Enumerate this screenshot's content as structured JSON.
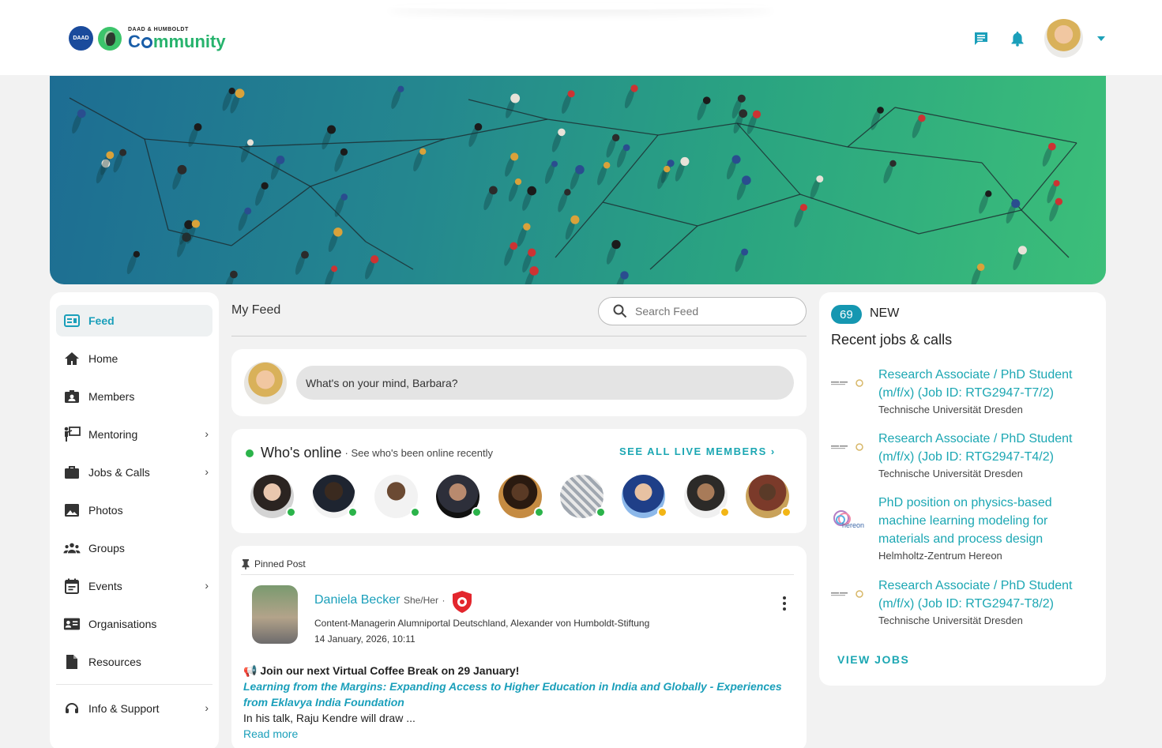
{
  "header": {
    "logo_badge": "DAAD",
    "logo_sub": "DAAD & HUMBOLDT",
    "logo_main_a": "C",
    "logo_main_b": "mmunity",
    "icons": [
      "chat-icon",
      "bell-icon"
    ],
    "colors": {
      "accent": "#1a9fba",
      "brand_blue": "#1a5ea8",
      "brand_green": "#27b36d"
    }
  },
  "nav": {
    "items": [
      {
        "label": "Feed",
        "icon": "feed-icon",
        "active": true,
        "has_submenu": false
      },
      {
        "label": "Home",
        "icon": "home-icon",
        "active": false,
        "has_submenu": false
      },
      {
        "label": "Members",
        "icon": "members-icon",
        "active": false,
        "has_submenu": false
      },
      {
        "label": "Mentoring",
        "icon": "mentoring-icon",
        "active": false,
        "has_submenu": true
      },
      {
        "label": "Jobs & Calls",
        "icon": "briefcase-icon",
        "active": false,
        "has_submenu": true
      },
      {
        "label": "Photos",
        "icon": "photo-icon",
        "active": false,
        "has_submenu": false
      },
      {
        "label": "Groups",
        "icon": "groups-icon",
        "active": false,
        "has_submenu": false
      },
      {
        "label": "Events",
        "icon": "calendar-icon",
        "active": false,
        "has_submenu": true
      },
      {
        "label": "Organisations",
        "icon": "organisation-icon",
        "active": false,
        "has_submenu": false
      },
      {
        "label": "Resources",
        "icon": "document-icon",
        "active": false,
        "has_submenu": false
      }
    ],
    "support": {
      "label": "Info & Support",
      "icon": "support-icon",
      "has_submenu": true
    },
    "chevron": "›"
  },
  "feed": {
    "title": "My Feed",
    "search_placeholder": "Search Feed",
    "compose_placeholder": "What's on your mind, Barbara?"
  },
  "online": {
    "title": "Who's online",
    "subtitle": "· See who's been online recently",
    "see_all": "SEE ALL LIVE MEMBERS ›",
    "members": [
      {
        "status": "online",
        "color": "#2bb34a"
      },
      {
        "status": "online",
        "color": "#2bb34a"
      },
      {
        "status": "online",
        "color": "#2bb34a"
      },
      {
        "status": "online",
        "color": "#2bb34a"
      },
      {
        "status": "online",
        "color": "#2bb34a"
      },
      {
        "status": "online",
        "color": "#2bb34a"
      },
      {
        "status": "recent",
        "color": "#f2b515"
      },
      {
        "status": "recent",
        "color": "#f2b515"
      },
      {
        "status": "recent",
        "color": "#f2b515"
      }
    ]
  },
  "pinned_post": {
    "label": "Pinned Post",
    "author": "Daniela Becker",
    "pronouns": "She/Her",
    "separator": "·",
    "role": "Content-Managerin Alumniportal Deutschland, Alexander von Humboldt-Stiftung",
    "date": "14 January, 2026, 10:11",
    "headline": "📢 Join our next Virtual Coffee Break on 29 January!",
    "link_text": "Learning from the Margins: Expanding Access to Higher Education in India and Globally - Experiences from Eklavya India Foundation",
    "excerpt": "In his talk, Raju Kendre will draw ...",
    "read_more": "Read more"
  },
  "jobs": {
    "count": "69",
    "new_label": "NEW",
    "title": "Recent jobs & calls",
    "items": [
      {
        "title": "Research Associate / PhD Student (m/f/x) (Job ID: RTG2947-T7/2)",
        "org": "Technische Universität Dresden",
        "logo": "tud-logo"
      },
      {
        "title": "Research Associate / PhD Student (m/f/x) (Job ID: RTG2947-T4/2)",
        "org": "Technische Universität Dresden",
        "logo": "tud-logo"
      },
      {
        "title": "PhD position on physics-based machine learning modeling for materials and process design",
        "org": "Helmholtz-Zentrum Hereon",
        "logo": "hereon-logo",
        "logo_text": "hereon"
      },
      {
        "title": "Research Associate / PhD Student (m/f/x) (Job ID: RTG2947-T8/2)",
        "org": "Technische Universität Dresden",
        "logo": "tud-logo"
      }
    ],
    "view_jobs": "VIEW JOBS"
  }
}
